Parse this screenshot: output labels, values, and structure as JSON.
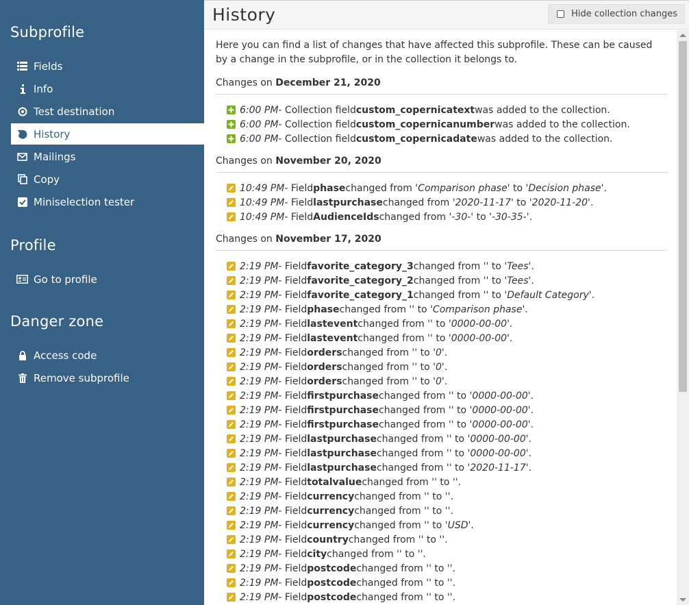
{
  "sidebar": {
    "sections": [
      {
        "title": "Subprofile",
        "items": [
          {
            "label": "Fields",
            "icon": "list-icon"
          },
          {
            "label": "Info",
            "icon": "info-icon"
          },
          {
            "label": "Test destination",
            "icon": "target-icon"
          },
          {
            "label": "History",
            "icon": "history-icon",
            "active": true
          },
          {
            "label": "Mailings",
            "icon": "envelope-icon"
          },
          {
            "label": "Copy",
            "icon": "copy-icon"
          },
          {
            "label": "Miniselection tester",
            "icon": "checkbox-icon"
          }
        ]
      },
      {
        "title": "Profile",
        "items": [
          {
            "label": "Go to profile",
            "icon": "id-card-icon"
          }
        ]
      },
      {
        "title": "Danger zone",
        "items": [
          {
            "label": "Access code",
            "icon": "lock-icon"
          },
          {
            "label": "Remove subprofile",
            "icon": "trash-icon"
          }
        ]
      }
    ]
  },
  "header": {
    "title": "History",
    "hide_button_label": "Hide collection changes"
  },
  "intro": "Here you can find a list of changes that have affected this subprofile. These can be caused by a change in the subprofile, or in the collection it belongs to.",
  "changes_prefix": "Changes on",
  "colors": {
    "sidebar": "#376185",
    "add": "#7cb31c",
    "edit": "#e3b21b"
  },
  "days": [
    {
      "date": "December 21, 2020",
      "entries": [
        {
          "type": "add",
          "time": "6:00 PM",
          "pre": " - Collection field ",
          "field": "custom_copernicatext",
          "post": " was added to the collection."
        },
        {
          "type": "add",
          "time": "6:00 PM",
          "pre": " - Collection field ",
          "field": "custom_copernicanumber",
          "post": " was added to the collection."
        },
        {
          "type": "add",
          "time": "6:00 PM",
          "pre": " - Collection field ",
          "field": "custom_copernicadate",
          "post": " was added to the collection."
        }
      ]
    },
    {
      "date": "November 20, 2020",
      "entries": [
        {
          "type": "edit",
          "time": "10:49 PM",
          "field": "phase",
          "from": "Comparison phase",
          "to": "Decision phase"
        },
        {
          "type": "edit",
          "time": "10:49 PM",
          "field": "lastpurchase",
          "from": "2020-11-17",
          "to": "2020-11-20"
        },
        {
          "type": "edit",
          "time": "10:49 PM",
          "field": "AudienceIds",
          "from": "-30-",
          "to": "-30-35-"
        }
      ]
    },
    {
      "date": "November 17, 2020",
      "entries": [
        {
          "type": "edit",
          "time": "2:19 PM",
          "field": "favorite_category_3",
          "from": "",
          "to": "Tees"
        },
        {
          "type": "edit",
          "time": "2:19 PM",
          "field": "favorite_category_2",
          "from": "",
          "to": "Tees"
        },
        {
          "type": "edit",
          "time": "2:19 PM",
          "field": "favorite_category_1",
          "from": "",
          "to": "Default Category"
        },
        {
          "type": "edit",
          "time": "2:19 PM",
          "field": "phase",
          "from": "",
          "to": "Comparison phase"
        },
        {
          "type": "edit",
          "time": "2:19 PM",
          "field": "lastevent",
          "from": "",
          "to": "0000-00-00"
        },
        {
          "type": "edit",
          "time": "2:19 PM",
          "field": "lastevent",
          "from": "",
          "to": "0000-00-00"
        },
        {
          "type": "edit",
          "time": "2:19 PM",
          "field": "orders",
          "from": "",
          "to": "0"
        },
        {
          "type": "edit",
          "time": "2:19 PM",
          "field": "orders",
          "from": "",
          "to": "0"
        },
        {
          "type": "edit",
          "time": "2:19 PM",
          "field": "orders",
          "from": "",
          "to": "0"
        },
        {
          "type": "edit",
          "time": "2:19 PM",
          "field": "firstpurchase",
          "from": "",
          "to": "0000-00-00"
        },
        {
          "type": "edit",
          "time": "2:19 PM",
          "field": "firstpurchase",
          "from": "",
          "to": "0000-00-00"
        },
        {
          "type": "edit",
          "time": "2:19 PM",
          "field": "firstpurchase",
          "from": "",
          "to": "0000-00-00"
        },
        {
          "type": "edit",
          "time": "2:19 PM",
          "field": "lastpurchase",
          "from": "",
          "to": "0000-00-00"
        },
        {
          "type": "edit",
          "time": "2:19 PM",
          "field": "lastpurchase",
          "from": "",
          "to": "0000-00-00"
        },
        {
          "type": "edit",
          "time": "2:19 PM",
          "field": "lastpurchase",
          "from": "",
          "to": "2020-11-17"
        },
        {
          "type": "edit",
          "time": "2:19 PM",
          "field": "totalvalue",
          "from": "",
          "to": ""
        },
        {
          "type": "edit",
          "time": "2:19 PM",
          "field": "currency",
          "from": "",
          "to": ""
        },
        {
          "type": "edit",
          "time": "2:19 PM",
          "field": "currency",
          "from": "",
          "to": ""
        },
        {
          "type": "edit",
          "time": "2:19 PM",
          "field": "currency",
          "from": "",
          "to": "USD"
        },
        {
          "type": "edit",
          "time": "2:19 PM",
          "field": "country",
          "from": "",
          "to": ""
        },
        {
          "type": "edit",
          "time": "2:19 PM",
          "field": "city",
          "from": "",
          "to": ""
        },
        {
          "type": "edit",
          "time": "2:19 PM",
          "field": "postcode",
          "from": "",
          "to": ""
        },
        {
          "type": "edit",
          "time": "2:19 PM",
          "field": "postcode",
          "from": "",
          "to": ""
        },
        {
          "type": "edit",
          "time": "2:19 PM",
          "field": "postcode",
          "from": "",
          "to": ""
        }
      ]
    }
  ]
}
